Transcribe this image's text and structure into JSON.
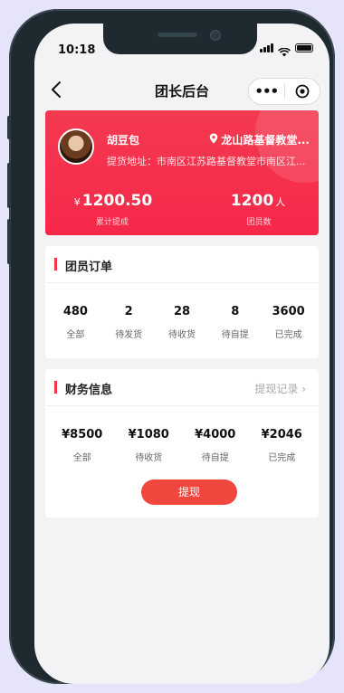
{
  "status_bar": {
    "time": "10:18"
  },
  "nav": {
    "title": "团长后台",
    "more": "•••"
  },
  "profile": {
    "name": "胡豆包",
    "location": "龙山路基督教堂...",
    "address": "提货地址：市南区江苏路基督教堂市南区江...",
    "withdrawn": {
      "currency": "¥",
      "value": "1200.50",
      "label": "累计提成"
    },
    "members": {
      "value": "1200",
      "unit": "人",
      "label": "团员数"
    }
  },
  "orders": {
    "title": "团员订单",
    "items": [
      {
        "count": "480",
        "label": "全部"
      },
      {
        "count": "2",
        "label": "待发货"
      },
      {
        "count": "28",
        "label": "待收货"
      },
      {
        "count": "8",
        "label": "待自提"
      },
      {
        "count": "3600",
        "label": "已完成"
      }
    ]
  },
  "finance": {
    "title": "财务信息",
    "link": "提现记录 ›",
    "items": [
      {
        "amount": "¥8500",
        "label": "全部"
      },
      {
        "amount": "¥1080",
        "label": "待收货"
      },
      {
        "amount": "¥4000",
        "label": "待自提"
      },
      {
        "amount": "¥2046",
        "label": "已完成"
      }
    ],
    "button": "提现"
  },
  "colors": {
    "accent": "#f0364b",
    "button": "#f2473f",
    "background": "#f3f3f5"
  }
}
